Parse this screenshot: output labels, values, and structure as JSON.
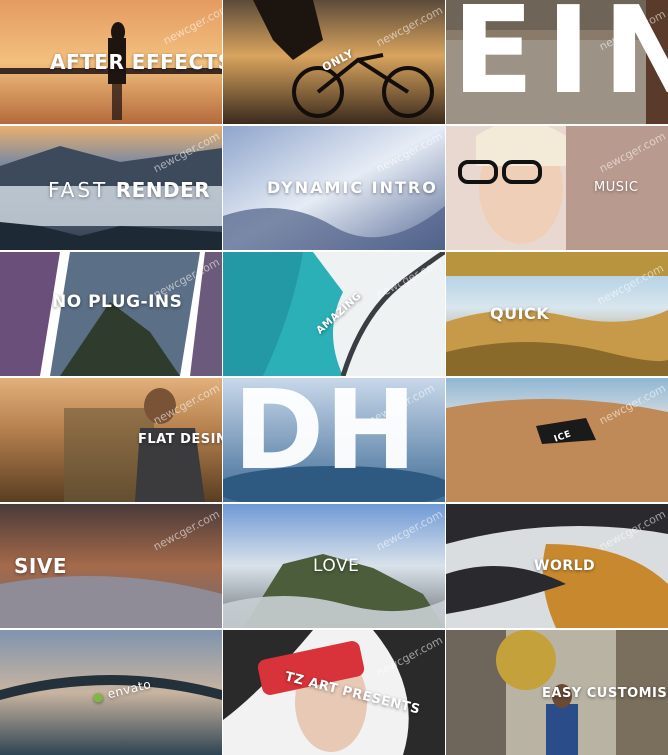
{
  "tiles": [
    {
      "caption": "AFTER EFFECTS"
    },
    {
      "caption": "ONLY"
    },
    {
      "caption": "EIN"
    },
    {
      "caption_light": "FAST",
      "caption_bold": "RENDER"
    },
    {
      "caption": "DYNAMIC INTRO"
    },
    {
      "caption": "MUSIC"
    },
    {
      "caption": "NO PLUG-INS"
    },
    {
      "caption": "AMAZING"
    },
    {
      "caption": "QUICK"
    },
    {
      "caption": "FLAT DESING"
    },
    {
      "caption": "DH"
    },
    {
      "caption": "ICE"
    },
    {
      "caption": "SIVE"
    },
    {
      "caption": "LOVE"
    },
    {
      "caption": "WORLD"
    },
    {
      "caption": "envato"
    },
    {
      "caption": "TZ ART PRESENTS"
    },
    {
      "caption": "EASY  CUSTOMISE"
    }
  ],
  "watermark": "newcger.com"
}
